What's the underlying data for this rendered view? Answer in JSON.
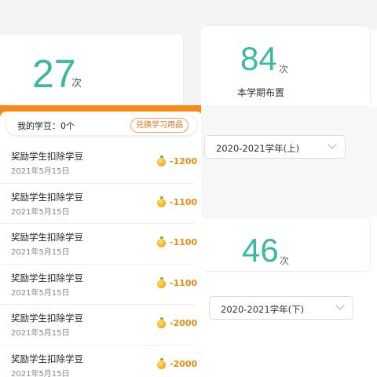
{
  "left": {
    "homework_count": "27",
    "count_unit": "次",
    "bean_label": "我的学豆：0个",
    "exchange_label": "兑换学习用品",
    "records": [
      {
        "title": "奖励学生扣除学豆",
        "date": "2021年5月15日",
        "amount": "-1200"
      },
      {
        "title": "奖励学生扣除学豆",
        "date": "2021年5月15日",
        "amount": "-1100"
      },
      {
        "title": "奖励学生扣除学豆",
        "date": "2021年5月15日",
        "amount": "-1100"
      },
      {
        "title": "奖励学生扣除学豆",
        "date": "2021年5月15日",
        "amount": "-1100"
      },
      {
        "title": "奖励学生扣除学豆",
        "date": "2021年5月15日",
        "amount": "-2000"
      },
      {
        "title": "奖励学生扣除学豆",
        "date": "2021年5月15日",
        "amount": "-2000"
      }
    ]
  },
  "right": {
    "semester_count": "84",
    "count_unit": "次",
    "semester_caption": "本学期布置",
    "term1_select": "2020-2021学年(上)",
    "term2_count": "46",
    "term2_select": "2020-2021学年(下)"
  },
  "colors": {
    "accent_green": "#3bb9a0",
    "orange": "#f58a1f",
    "amount_orange": "#e98a12"
  }
}
